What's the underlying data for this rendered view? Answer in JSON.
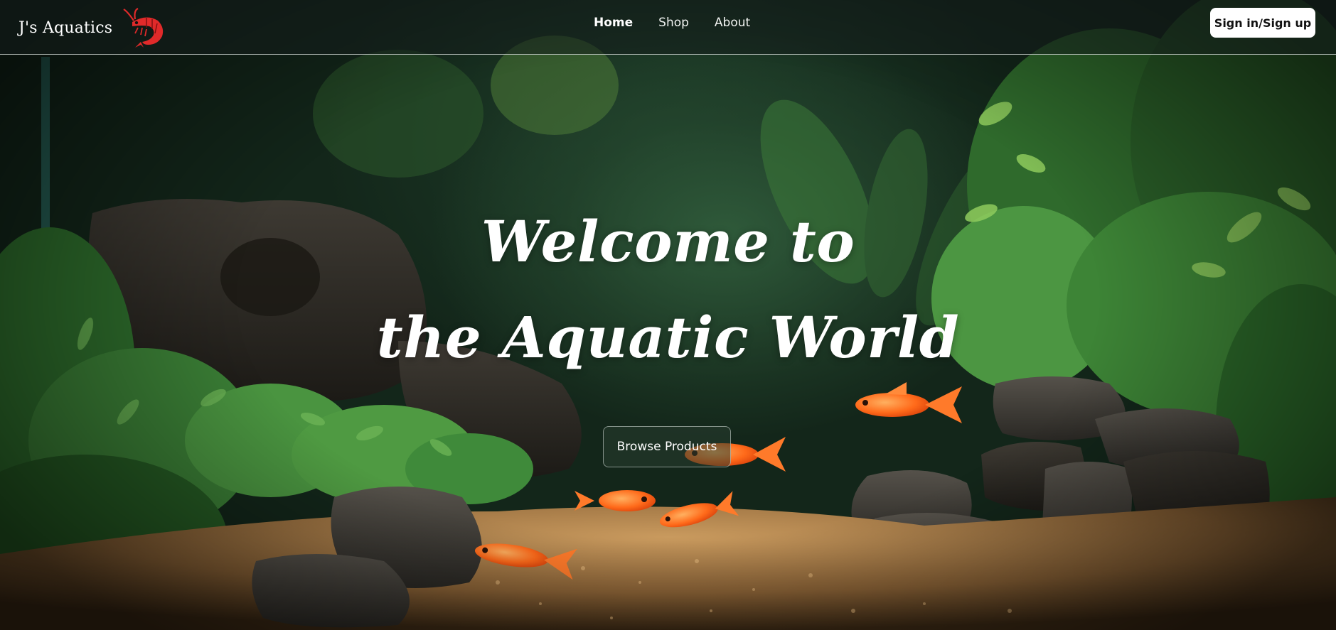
{
  "header": {
    "brand_name": "J's Aquatics",
    "logo_icon": "shrimp-icon",
    "nav": [
      {
        "label": "Home",
        "active": true
      },
      {
        "label": "Shop",
        "active": false
      },
      {
        "label": "About",
        "active": false
      }
    ],
    "signin_label": "Sign in/Sign up"
  },
  "hero": {
    "title_line1": "Welcome to",
    "title_line2": "the Aquatic World",
    "cta_label": "Browse Products"
  },
  "colors": {
    "accent_logo": "#e02a2a",
    "fish_orange": "#ff6a1a",
    "foliage": "#3f8a3a",
    "gravel": "#b88a52"
  }
}
